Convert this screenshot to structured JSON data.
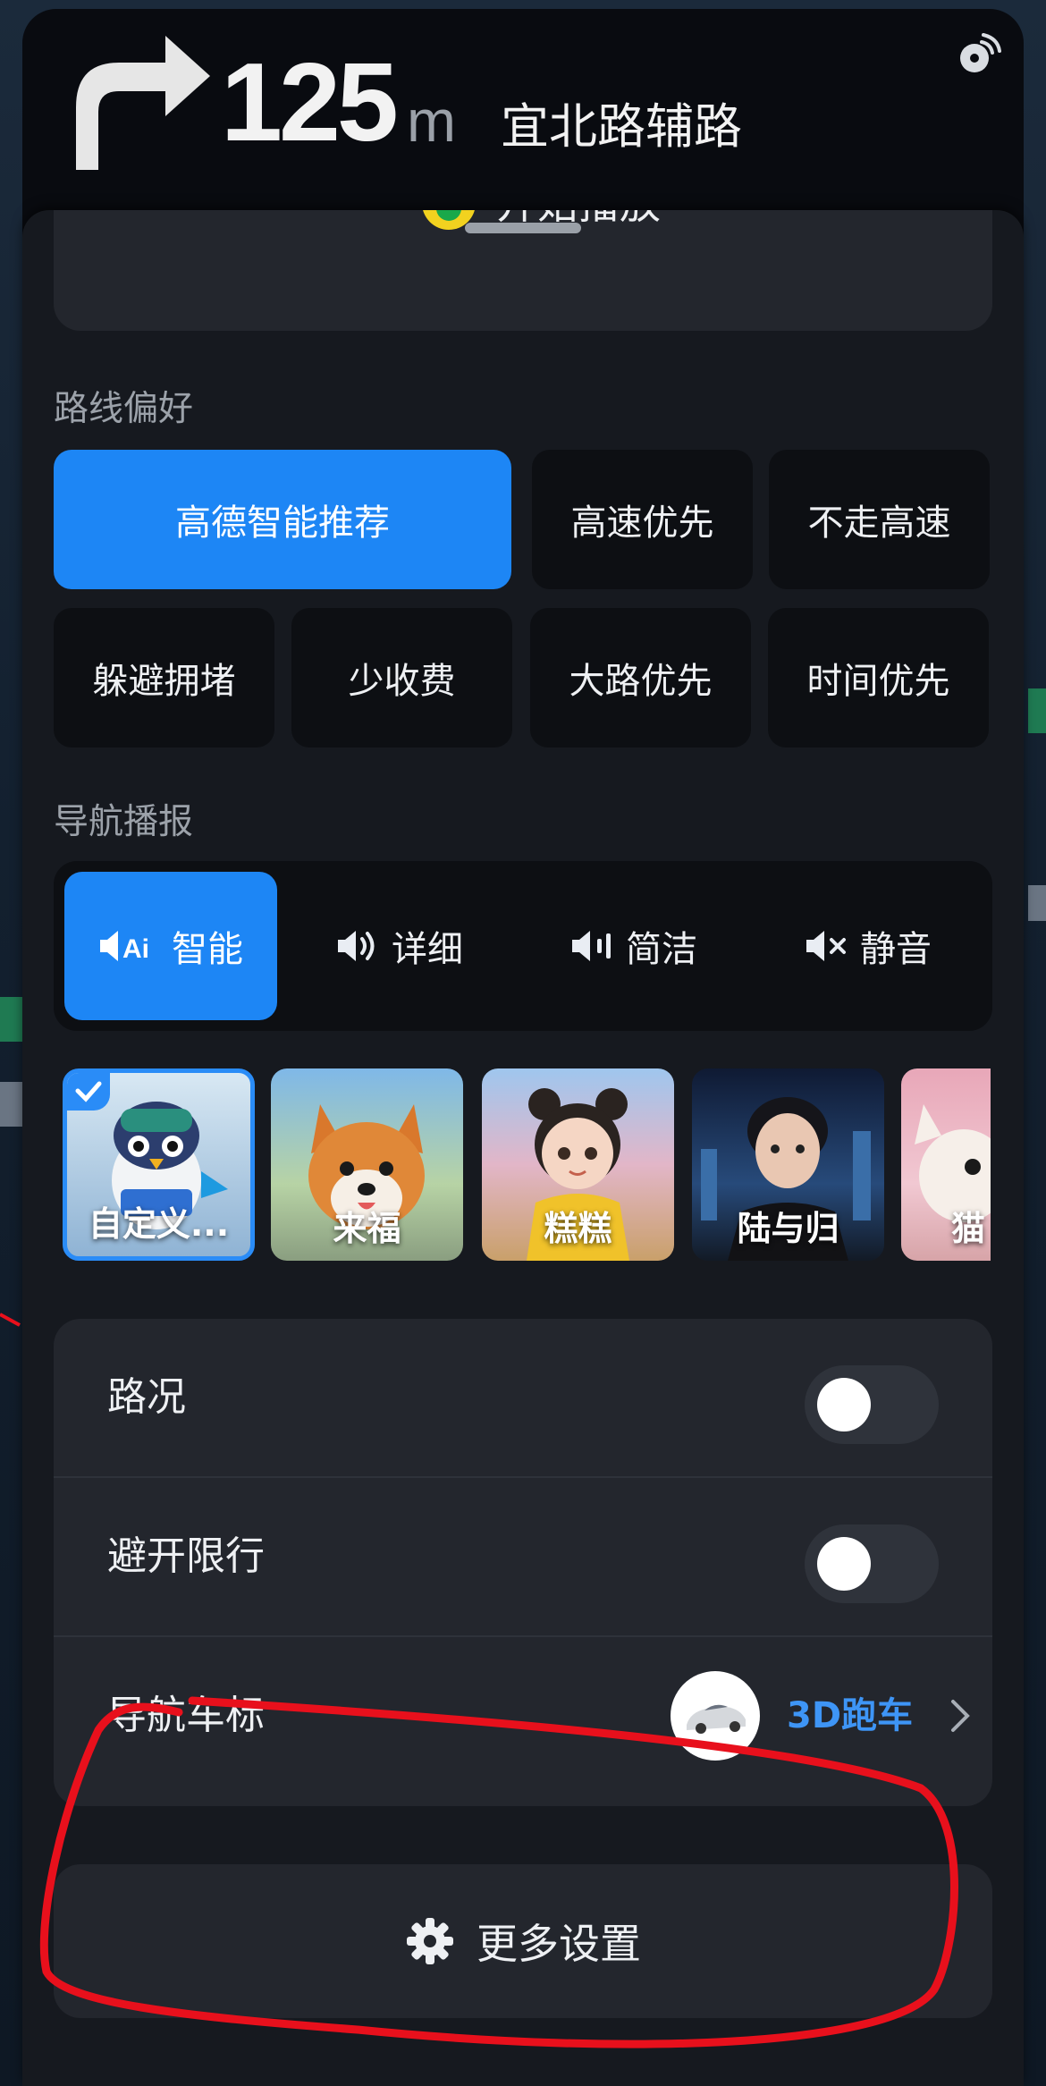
{
  "guidance": {
    "distance": "125",
    "unit": "m",
    "road": "宜北路辅路",
    "turn_icon": "turn-right-arrow",
    "status_icon": "satellite-dish"
  },
  "music": {
    "label": "开始播放",
    "icon": "music-app"
  },
  "route_preference": {
    "title": "路线偏好",
    "options": [
      "高德智能推荐",
      "高速优先",
      "不走高速",
      "躲避拥堵",
      "少收费",
      "大路优先",
      "时间优先"
    ],
    "selected": "高德智能推荐"
  },
  "broadcast": {
    "title": "导航播报",
    "modes": [
      {
        "label": "智能",
        "icon": "ai-speaker"
      },
      {
        "label": "详细",
        "icon": "speaker-loud"
      },
      {
        "label": "简洁",
        "icon": "speaker-low"
      },
      {
        "label": "静音",
        "icon": "speaker-mute"
      }
    ],
    "selected": "智能"
  },
  "voices": [
    "自定义...",
    "来福",
    "糕糕",
    "陆与归",
    "猫"
  ],
  "selected_voice": "自定义...",
  "settings": {
    "traffic": {
      "label": "路况",
      "enabled": false
    },
    "avoid_restriction": {
      "label": "避开限行",
      "enabled": false
    },
    "car_icon": {
      "label": "导航车标",
      "value": "3D跑车"
    }
  },
  "more_settings": {
    "label": "更多设置",
    "icon": "gear"
  },
  "colors": {
    "accent": "#1d86f5",
    "panel": "#16191f",
    "card": "#23262d",
    "annotation": "#e8101c"
  }
}
